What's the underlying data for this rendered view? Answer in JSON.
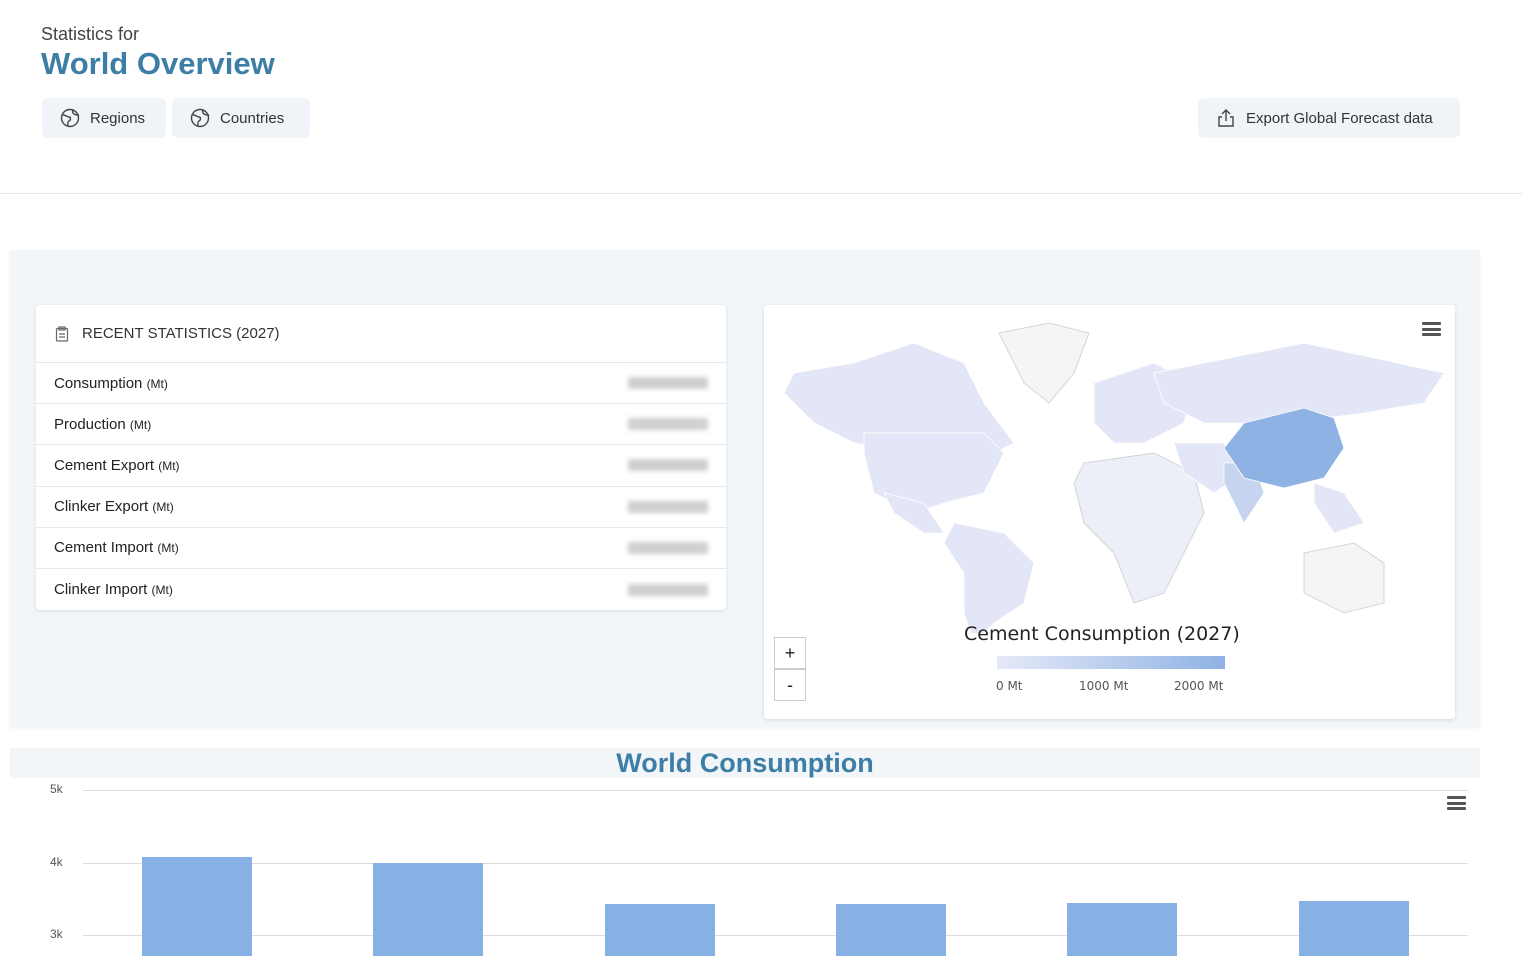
{
  "header": {
    "subtitle": "Statistics for",
    "title": "World Overview"
  },
  "buttons": {
    "regions": "Regions",
    "countries": "Countries",
    "export": "Export Global Forecast data"
  },
  "stats": {
    "title": "RECENT STATISTICS (2027)",
    "rows": [
      {
        "label": "Consumption",
        "unit": "(Mt)"
      },
      {
        "label": "Production",
        "unit": "(Mt)"
      },
      {
        "label": "Cement Export",
        "unit": "(Mt)"
      },
      {
        "label": "Clinker Export",
        "unit": "(Mt)"
      },
      {
        "label": "Cement Import",
        "unit": "(Mt)"
      },
      {
        "label": "Clinker Import",
        "unit": "(Mt)"
      }
    ]
  },
  "map": {
    "legend_title": "Cement Consumption (2027)",
    "legend_labels": [
      "0 Mt",
      "1000 Mt",
      "2000 Mt"
    ],
    "zoom_in": "+",
    "zoom_out": "-",
    "colors": {
      "low": "#e6e9f7",
      "high": "#8eb2e4"
    }
  },
  "chart_data": {
    "type": "bar",
    "title": "World Consumption",
    "yticks": [
      "3k",
      "4k",
      "5k"
    ],
    "values": [
      4070,
      3990,
      3430,
      3430,
      3440,
      3470
    ],
    "ylim_visible": [
      3000,
      5000
    ],
    "color": "#87b1e4",
    "grid": true
  }
}
